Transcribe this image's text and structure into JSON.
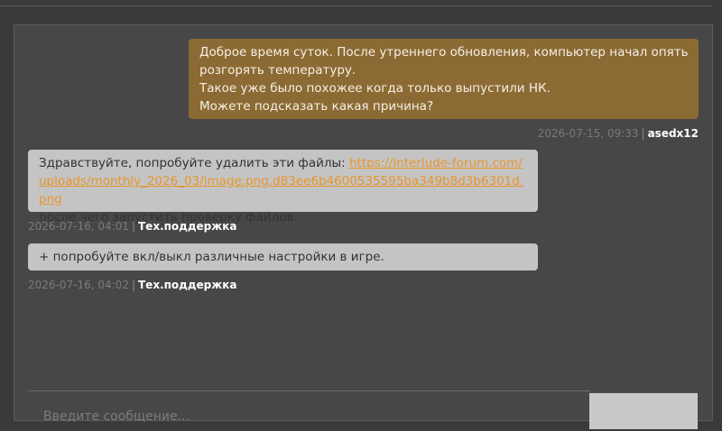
{
  "conversation": {
    "messages": [
      {
        "lines": [
          "Доброе время суток. После утреннего обновления, компьютер начал опять",
          "розгорять температуру.",
          "Такое уже было похожее когда только выпустили НК.",
          "Можете подсказать какая причина?"
        ],
        "timestamp": "2026-07-15, 09:33",
        "author": "asedx12"
      },
      {
        "text_before": "Здравствуйте, попробуйте удалить эти файлы: ",
        "link": "https://interlude-forum.com/uploads/monthly_2026_03/image.png.d83ee6b4600535595ba349b8d3b6301d.png",
        "text_after": "после чего запустить проверку файлов.",
        "timestamp": "2026-07-16, 04:01",
        "author": "Тех.поддержка"
      },
      {
        "text": "+ попробуйте вкл/выкл различные настройки в игре.",
        "timestamp": "2026-07-16, 04:02",
        "author": "Тех.поддержка"
      }
    ],
    "separator": "|"
  },
  "composer": {
    "placeholder": "Введите сообщение..."
  },
  "colors": {
    "user_bubble": "#8c6a33",
    "support_bubble": "#c4c4c4",
    "link": "#e8962c",
    "panel": "#474747"
  }
}
